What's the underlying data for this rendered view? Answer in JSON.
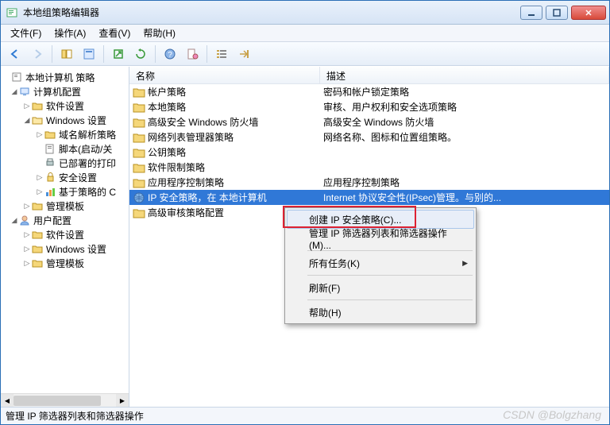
{
  "title": "本地组策略编辑器",
  "menus": {
    "file": "文件(F)",
    "action": "操作(A)",
    "view": "查看(V)",
    "help": "帮助(H)"
  },
  "tree": {
    "root": "本地计算机 策略",
    "computer_cfg": "计算机配置",
    "software_settings": "软件设置",
    "windows_settings": "Windows 设置",
    "dns_policy": "域名解析策略",
    "scripts": "脚本(启动/关",
    "printers": "已部署的打印",
    "security_settings": "安全设置",
    "policy_based": "基于策略的 C",
    "admin_templates": "管理模板",
    "user_cfg": "用户配置",
    "u_software": "软件设置",
    "u_windows": "Windows 设置",
    "u_admin": "管理模板"
  },
  "columns": {
    "name": "名称",
    "desc": "描述"
  },
  "rows": [
    {
      "name": "帐户策略",
      "desc": "密码和帐户锁定策略",
      "icon": "folder"
    },
    {
      "name": "本地策略",
      "desc": "审核、用户权利和安全选项策略",
      "icon": "folder"
    },
    {
      "name": "高级安全 Windows 防火墙",
      "desc": "高级安全 Windows 防火墙",
      "icon": "folder"
    },
    {
      "name": "网络列表管理器策略",
      "desc": "网络名称、图标和位置组策略。",
      "icon": "folder"
    },
    {
      "name": "公钥策略",
      "desc": "",
      "icon": "folder"
    },
    {
      "name": "软件限制策略",
      "desc": "",
      "icon": "folder"
    },
    {
      "name": "应用程序控制策略",
      "desc": "应用程序控制策略",
      "icon": "folder"
    },
    {
      "name": "IP 安全策略，在 本地计算机",
      "desc": "Internet 协议安全性(IPsec)管理。与别的...",
      "icon": "globe",
      "selected": true
    },
    {
      "name": "高级审核策略配置",
      "desc": "",
      "icon": "folder"
    }
  ],
  "context_menu": {
    "create": "创建 IP 安全策略(C)...",
    "manage": "管理 IP 筛选器列表和筛选器操作(M)...",
    "all_tasks": "所有任务(K)",
    "refresh": "刷新(F)",
    "help": "帮助(H)"
  },
  "status": "管理 IP 筛选器列表和筛选器操作",
  "watermark": "CSDN @Bolgzhang"
}
